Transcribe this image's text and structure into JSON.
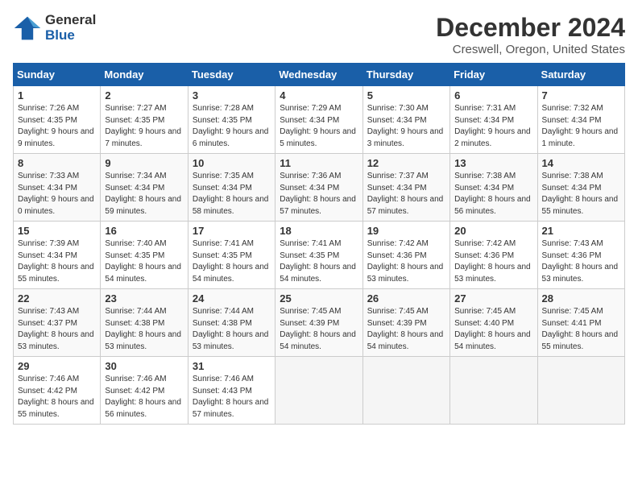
{
  "header": {
    "logo_general": "General",
    "logo_blue": "Blue",
    "title": "December 2024",
    "subtitle": "Creswell, Oregon, United States"
  },
  "calendar": {
    "days_of_week": [
      "Sunday",
      "Monday",
      "Tuesday",
      "Wednesday",
      "Thursday",
      "Friday",
      "Saturday"
    ],
    "weeks": [
      [
        {
          "day": "1",
          "sunrise": "7:26 AM",
          "sunset": "4:35 PM",
          "daylight": "9 hours and 9 minutes."
        },
        {
          "day": "2",
          "sunrise": "7:27 AM",
          "sunset": "4:35 PM",
          "daylight": "9 hours and 7 minutes."
        },
        {
          "day": "3",
          "sunrise": "7:28 AM",
          "sunset": "4:35 PM",
          "daylight": "9 hours and 6 minutes."
        },
        {
          "day": "4",
          "sunrise": "7:29 AM",
          "sunset": "4:34 PM",
          "daylight": "9 hours and 5 minutes."
        },
        {
          "day": "5",
          "sunrise": "7:30 AM",
          "sunset": "4:34 PM",
          "daylight": "9 hours and 3 minutes."
        },
        {
          "day": "6",
          "sunrise": "7:31 AM",
          "sunset": "4:34 PM",
          "daylight": "9 hours and 2 minutes."
        },
        {
          "day": "7",
          "sunrise": "7:32 AM",
          "sunset": "4:34 PM",
          "daylight": "9 hours and 1 minute."
        }
      ],
      [
        {
          "day": "8",
          "sunrise": "7:33 AM",
          "sunset": "4:34 PM",
          "daylight": "9 hours and 0 minutes."
        },
        {
          "day": "9",
          "sunrise": "7:34 AM",
          "sunset": "4:34 PM",
          "daylight": "8 hours and 59 minutes."
        },
        {
          "day": "10",
          "sunrise": "7:35 AM",
          "sunset": "4:34 PM",
          "daylight": "8 hours and 58 minutes."
        },
        {
          "day": "11",
          "sunrise": "7:36 AM",
          "sunset": "4:34 PM",
          "daylight": "8 hours and 57 minutes."
        },
        {
          "day": "12",
          "sunrise": "7:37 AM",
          "sunset": "4:34 PM",
          "daylight": "8 hours and 57 minutes."
        },
        {
          "day": "13",
          "sunrise": "7:38 AM",
          "sunset": "4:34 PM",
          "daylight": "8 hours and 56 minutes."
        },
        {
          "day": "14",
          "sunrise": "7:38 AM",
          "sunset": "4:34 PM",
          "daylight": "8 hours and 55 minutes."
        }
      ],
      [
        {
          "day": "15",
          "sunrise": "7:39 AM",
          "sunset": "4:34 PM",
          "daylight": "8 hours and 55 minutes."
        },
        {
          "day": "16",
          "sunrise": "7:40 AM",
          "sunset": "4:35 PM",
          "daylight": "8 hours and 54 minutes."
        },
        {
          "day": "17",
          "sunrise": "7:41 AM",
          "sunset": "4:35 PM",
          "daylight": "8 hours and 54 minutes."
        },
        {
          "day": "18",
          "sunrise": "7:41 AM",
          "sunset": "4:35 PM",
          "daylight": "8 hours and 54 minutes."
        },
        {
          "day": "19",
          "sunrise": "7:42 AM",
          "sunset": "4:36 PM",
          "daylight": "8 hours and 53 minutes."
        },
        {
          "day": "20",
          "sunrise": "7:42 AM",
          "sunset": "4:36 PM",
          "daylight": "8 hours and 53 minutes."
        },
        {
          "day": "21",
          "sunrise": "7:43 AM",
          "sunset": "4:36 PM",
          "daylight": "8 hours and 53 minutes."
        }
      ],
      [
        {
          "day": "22",
          "sunrise": "7:43 AM",
          "sunset": "4:37 PM",
          "daylight": "8 hours and 53 minutes."
        },
        {
          "day": "23",
          "sunrise": "7:44 AM",
          "sunset": "4:38 PM",
          "daylight": "8 hours and 53 minutes."
        },
        {
          "day": "24",
          "sunrise": "7:44 AM",
          "sunset": "4:38 PM",
          "daylight": "8 hours and 53 minutes."
        },
        {
          "day": "25",
          "sunrise": "7:45 AM",
          "sunset": "4:39 PM",
          "daylight": "8 hours and 54 minutes."
        },
        {
          "day": "26",
          "sunrise": "7:45 AM",
          "sunset": "4:39 PM",
          "daylight": "8 hours and 54 minutes."
        },
        {
          "day": "27",
          "sunrise": "7:45 AM",
          "sunset": "4:40 PM",
          "daylight": "8 hours and 54 minutes."
        },
        {
          "day": "28",
          "sunrise": "7:45 AM",
          "sunset": "4:41 PM",
          "daylight": "8 hours and 55 minutes."
        }
      ],
      [
        {
          "day": "29",
          "sunrise": "7:46 AM",
          "sunset": "4:42 PM",
          "daylight": "8 hours and 55 minutes."
        },
        {
          "day": "30",
          "sunrise": "7:46 AM",
          "sunset": "4:42 PM",
          "daylight": "8 hours and 56 minutes."
        },
        {
          "day": "31",
          "sunrise": "7:46 AM",
          "sunset": "4:43 PM",
          "daylight": "8 hours and 57 minutes."
        },
        null,
        null,
        null,
        null
      ]
    ]
  }
}
